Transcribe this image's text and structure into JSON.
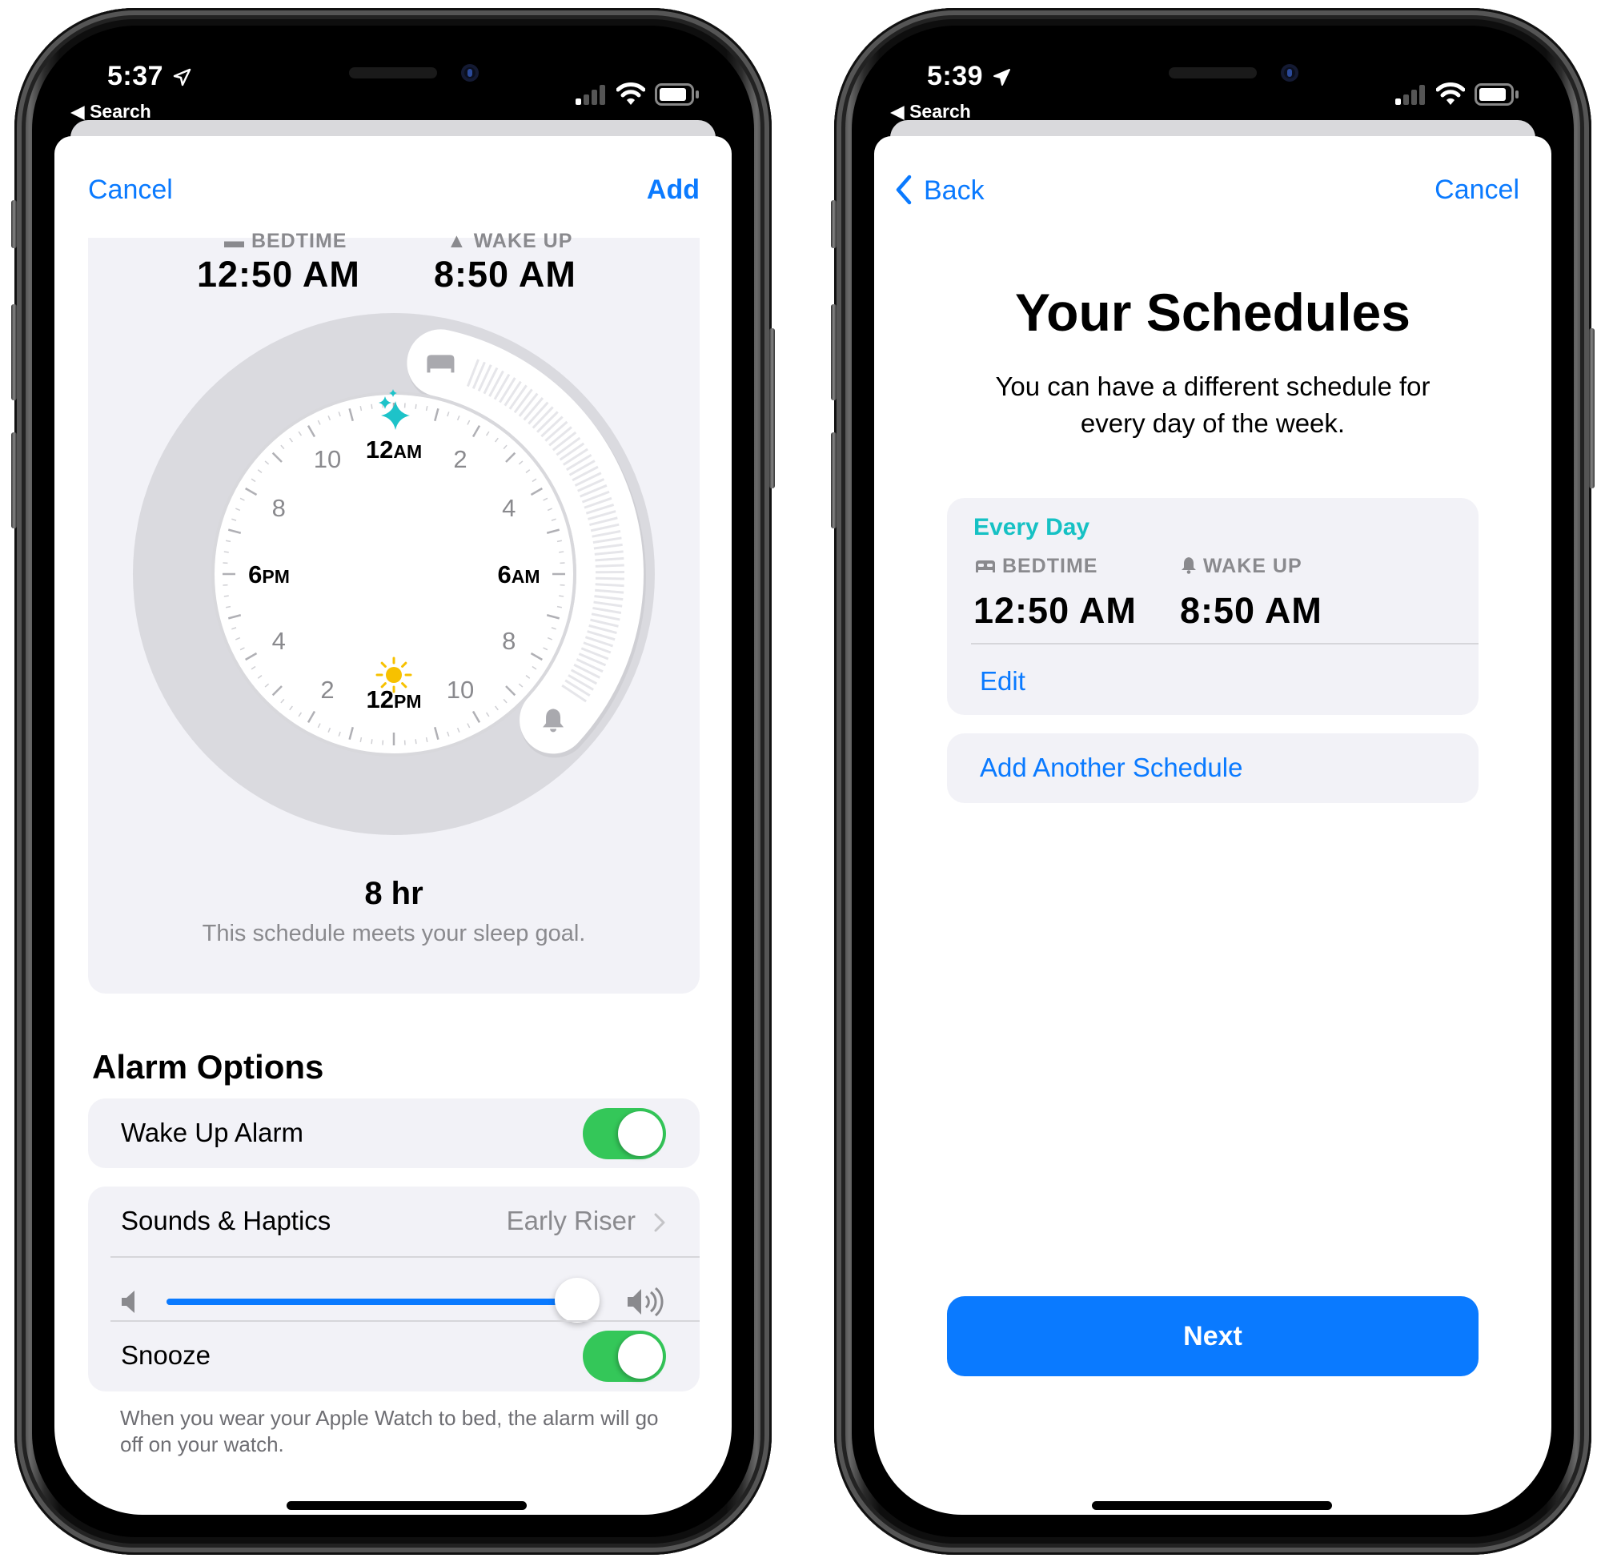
{
  "left_phone": {
    "status_bar": {
      "time": "5:37",
      "back_label": "Search",
      "signal_bars_active": 1,
      "signal_bars_total": 4
    },
    "nav": {
      "cancel_label": "Cancel",
      "add_label": "Add"
    },
    "schedule_card": {
      "bedtime_label": "BEDTIME",
      "wakeup_label": "WAKE UP",
      "bedtime_value": "12:50 AM",
      "wakeup_value": "8:50 AM",
      "clock": {
        "hour_labels": [
          {
            "hour": 0,
            "num": "12",
            "suffix": "AM",
            "major": true
          },
          {
            "hour": 2,
            "num": "2",
            "suffix": "",
            "major": false
          },
          {
            "hour": 4,
            "num": "4",
            "suffix": "",
            "major": false
          },
          {
            "hour": 6,
            "num": "6",
            "suffix": "AM",
            "major": true
          },
          {
            "hour": 8,
            "num": "8",
            "suffix": "",
            "major": false
          },
          {
            "hour": 10,
            "num": "10",
            "suffix": "",
            "major": false
          },
          {
            "hour": 12,
            "num": "12",
            "suffix": "PM",
            "major": true
          },
          {
            "hour": 14,
            "num": "2",
            "suffix": "",
            "major": false
          },
          {
            "hour": 16,
            "num": "4",
            "suffix": "",
            "major": false
          },
          {
            "hour": 18,
            "num": "6",
            "suffix": "PM",
            "major": true
          },
          {
            "hour": 20,
            "num": "8",
            "suffix": "",
            "major": false
          },
          {
            "hour": 22,
            "num": "10",
            "suffix": "",
            "major": false
          }
        ],
        "bedtime_hours": 0.8333,
        "wakeup_hours": 8.8333,
        "night_icon": "sparkles-icon",
        "day_icon": "sun-icon",
        "colors": {
          "night": "#1dc3c9",
          "sun": "#f7c100"
        }
      },
      "duration": "8 hr",
      "goal_message": "This schedule meets your sleep goal."
    },
    "alarm_options": {
      "heading": "Alarm Options",
      "wake_up_alarm_label": "Wake Up Alarm",
      "wake_up_alarm_on": true,
      "sounds_label": "Sounds & Haptics",
      "sounds_value": "Early Riser",
      "volume_fraction": 0.95,
      "snooze_label": "Snooze",
      "snooze_on": true,
      "footer": "When you wear your Apple Watch to bed, the alarm will go off on your watch."
    }
  },
  "right_phone": {
    "status_bar": {
      "time": "5:39",
      "back_label": "Search",
      "signal_bars_active": 1,
      "signal_bars_total": 4
    },
    "nav": {
      "back_label": "Back",
      "cancel_label": "Cancel"
    },
    "title": "Your Schedules",
    "subtitle_line1": "You can have a different schedule for",
    "subtitle_line2": "every day of the week.",
    "schedule": {
      "days": "Every Day",
      "bedtime_label": "BEDTIME",
      "wakeup_label": "WAKE UP",
      "bedtime_value": "12:50 AM",
      "wakeup_value": "8:50 AM",
      "edit_label": "Edit"
    },
    "add_another_label": "Add Another Schedule",
    "next_label": "Next"
  },
  "colors": {
    "accent_blue": "#0a7aff",
    "toggle_green": "#34c759",
    "teal": "#16c1c4",
    "secondary_gray": "#8a8a8e",
    "grouped_bg": "#f2f2f7"
  }
}
